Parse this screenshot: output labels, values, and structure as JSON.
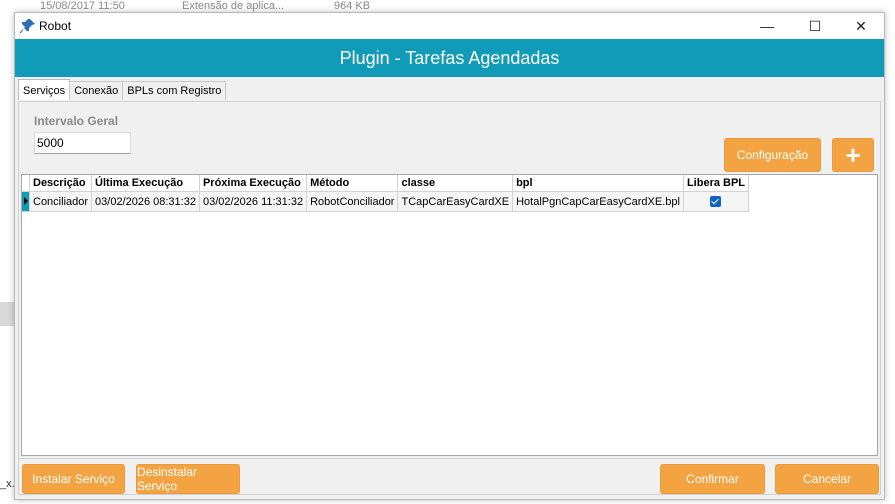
{
  "background": {
    "file_date": "15/08/2017 11:50",
    "file_type": "Extensão de aplica...",
    "file_size": "964 KB",
    "left_text": "_x."
  },
  "window": {
    "title": "Robot",
    "banner_title": "Plugin - Tarefas Agendadas",
    "controls": {
      "minimize": "—",
      "maximize": "☐",
      "close": "✕"
    }
  },
  "tabs": [
    {
      "label": "Serviços",
      "active": true
    },
    {
      "label": "Conexão",
      "active": false
    },
    {
      "label": "BPLs com Registro",
      "active": false
    }
  ],
  "interval": {
    "label": "Intervalo Geral",
    "value": "5000"
  },
  "toolbar": {
    "config_label": "Configuração",
    "add_label": "+"
  },
  "grid": {
    "columns": [
      "Descrição",
      "Última Execução",
      "Próxima Execução",
      "Método",
      "classe",
      "bpl",
      "Libera BPL"
    ],
    "rows": [
      {
        "descricao": "Conciliador",
        "ultima": "03/02/2026 08:31:32",
        "proxima": "03/02/2026 11:31:32",
        "metodo": "RobotConciliador",
        "classe": "TCapCarEasyCardXE",
        "bpl": "HotalPgnCapCarEasyCardXE.bpl",
        "libera": true
      }
    ]
  },
  "footer": {
    "install_label": "Instalar Serviço",
    "uninstall_label": "Desinstalar Serviço",
    "confirm_label": "Confirmar",
    "cancel_label": "Cancelar"
  },
  "colors": {
    "accent": "#109bb8",
    "button": "#f4a342",
    "checkbox": "#0f62c4"
  }
}
